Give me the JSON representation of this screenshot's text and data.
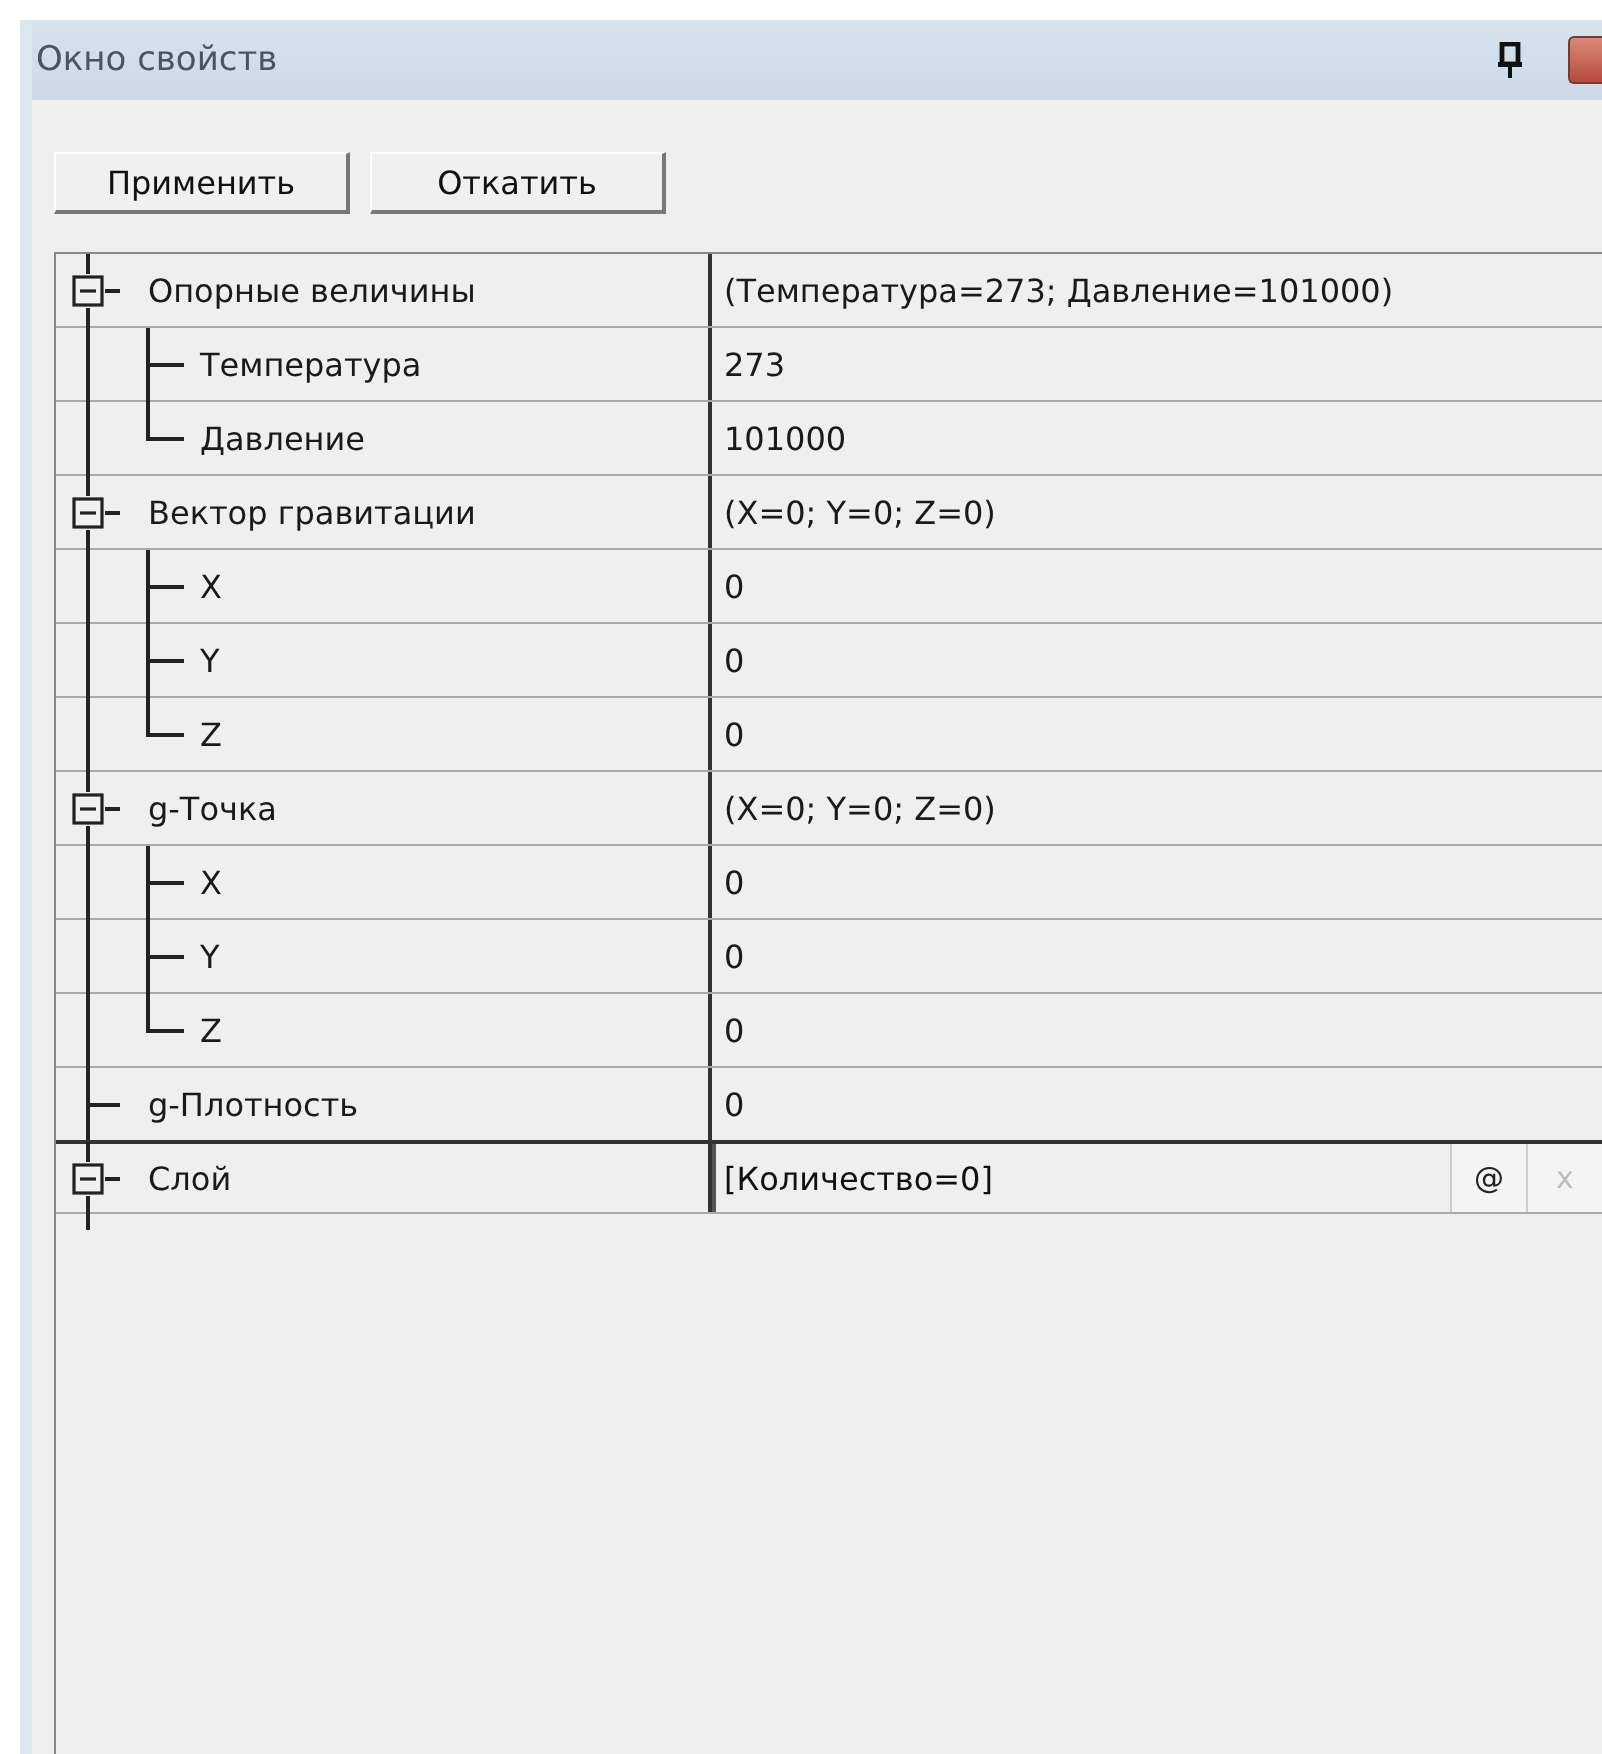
{
  "window": {
    "title": "Окно свойств"
  },
  "toolbar": [
    {
      "label": "Применить"
    },
    {
      "label": "Откатить"
    }
  ],
  "properties": [
    {
      "name": "Опорные величины",
      "value": "(Температура=273; Давление=101000)",
      "kind": "text",
      "expanded": true,
      "selected": false,
      "children": [
        {
          "name": "Температура",
          "value": "273",
          "kind": "text",
          "selected": false
        },
        {
          "name": "Давление",
          "value": "101000",
          "kind": "text",
          "selected": false
        }
      ]
    },
    {
      "name": "Вектор гравитации",
      "value": "(X=0; Y=0; Z=0)",
      "kind": "text",
      "expanded": true,
      "selected": false,
      "children": [
        {
          "name": "X",
          "value": "0",
          "kind": "text",
          "selected": false
        },
        {
          "name": "Y",
          "value": "0",
          "kind": "text",
          "selected": false
        },
        {
          "name": "Z",
          "value": "0",
          "kind": "text",
          "selected": false
        }
      ]
    },
    {
      "name": "g-Точка",
      "value": "(X=0; Y=0; Z=0)",
      "kind": "text",
      "expanded": true,
      "selected": false,
      "children": [
        {
          "name": "X",
          "value": "0",
          "kind": "text",
          "selected": false
        },
        {
          "name": "Y",
          "value": "0",
          "kind": "text",
          "selected": false
        },
        {
          "name": "Z",
          "value": "0",
          "kind": "text",
          "selected": false
        }
      ]
    },
    {
      "name": "g-Плотность",
      "value": "0",
      "kind": "text",
      "selected": false
    },
    {
      "name": "Слой",
      "value": "[Количество=0]",
      "kind": "editor",
      "expanded": true,
      "selected": true,
      "buttons": [
        {
          "label": "@",
          "disabled": false
        },
        {
          "label": "x",
          "disabled": true
        }
      ]
    }
  ]
}
